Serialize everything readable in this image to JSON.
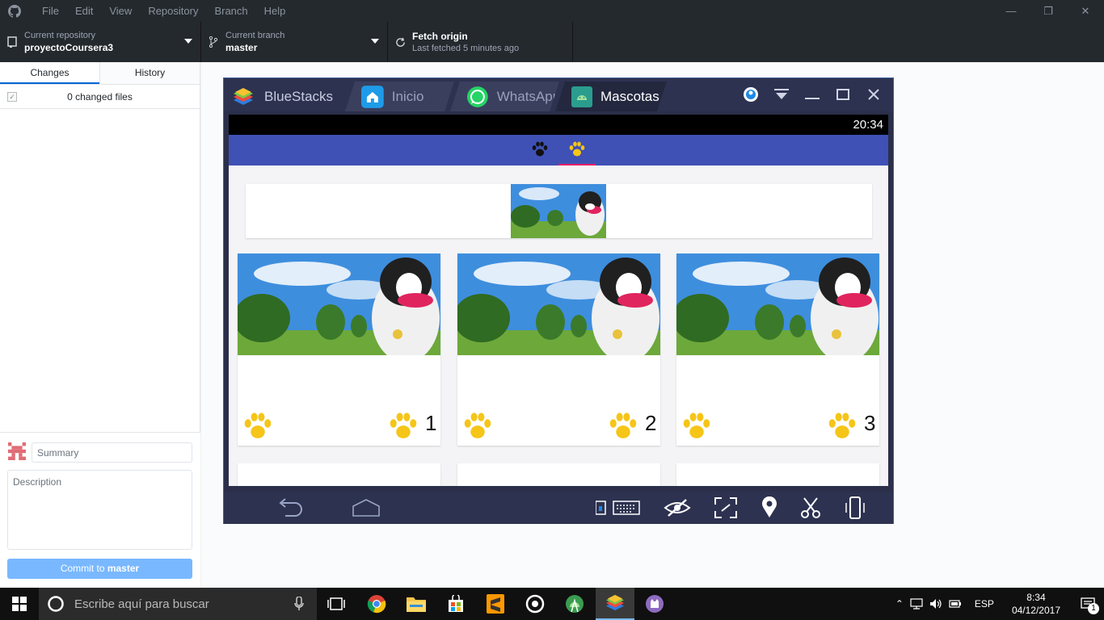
{
  "titlebar": {
    "menu": [
      "File",
      "Edit",
      "View",
      "Repository",
      "Branch",
      "Help"
    ]
  },
  "toolbar": {
    "repo_label": "Current repository",
    "repo_value": "proyectoCoursera3",
    "branch_label": "Current branch",
    "branch_value": "master",
    "fetch_label": "Fetch origin",
    "fetch_sub": "Last fetched 5 minutes ago"
  },
  "sidebar": {
    "tabs": [
      "Changes",
      "History"
    ],
    "changed_files": "0 changed files",
    "summary_placeholder": "Summary",
    "description_placeholder": "Description",
    "commit_prefix": "Commit to ",
    "commit_branch": "master"
  },
  "bluestacks": {
    "tabs": [
      "BlueStacks",
      "Inicio",
      "WhatsApp",
      "Mascotas"
    ],
    "time": "20:34",
    "cards": [
      {
        "rating": "1"
      },
      {
        "rating": "2"
      },
      {
        "rating": "3"
      }
    ]
  },
  "taskbar": {
    "search_placeholder": "Escribe aquí para buscar",
    "lang": "ESP",
    "time": "8:34",
    "date": "04/12/2017",
    "notifications": "1"
  },
  "colors": {
    "app_bar": "#3f51b5",
    "paw": "#f5c518",
    "commit_button": "#79b8ff"
  }
}
